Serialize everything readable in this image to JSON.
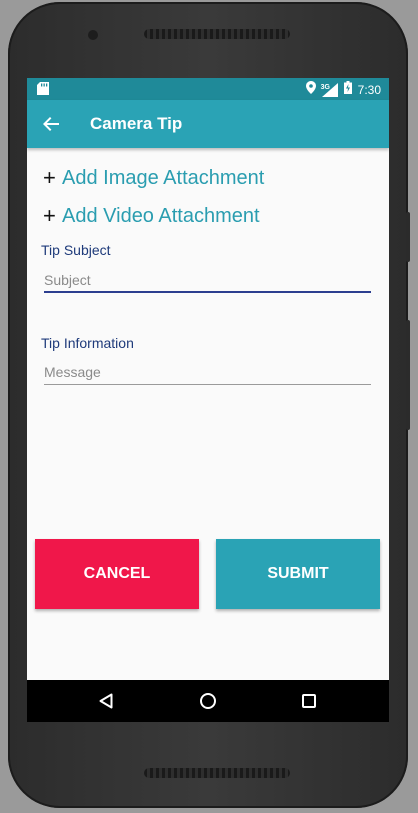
{
  "status_bar": {
    "time": "7:30",
    "network_label": "3G",
    "icons": [
      "sd-card-icon",
      "location-icon",
      "signal-icon",
      "battery-icon"
    ]
  },
  "app_bar": {
    "title": "Camera Tip",
    "back_icon": "arrow-back-icon"
  },
  "attachments": {
    "image": {
      "plus": "+",
      "label": "Add Image Attachment"
    },
    "video": {
      "plus": "+",
      "label": "Add Video Attachment"
    }
  },
  "form": {
    "subject": {
      "label": "Tip Subject",
      "placeholder": "Subject",
      "value": ""
    },
    "information": {
      "label": "Tip Information",
      "placeholder": "Message",
      "value": ""
    }
  },
  "actions": {
    "cancel": "CANCEL",
    "submit": "SUBMIT"
  },
  "nav_bar": {
    "icons": [
      "back-triangle-icon",
      "home-circle-icon",
      "recents-square-icon"
    ]
  },
  "colors": {
    "primary": "#2aa3b5",
    "primary_dark": "#1f8a99",
    "accent_text": "#2a9db0",
    "label_text": "#1e3a7a",
    "cancel": "#f0174a",
    "submit": "#2aa3b5",
    "focused_underline": "#2c3e8f"
  }
}
